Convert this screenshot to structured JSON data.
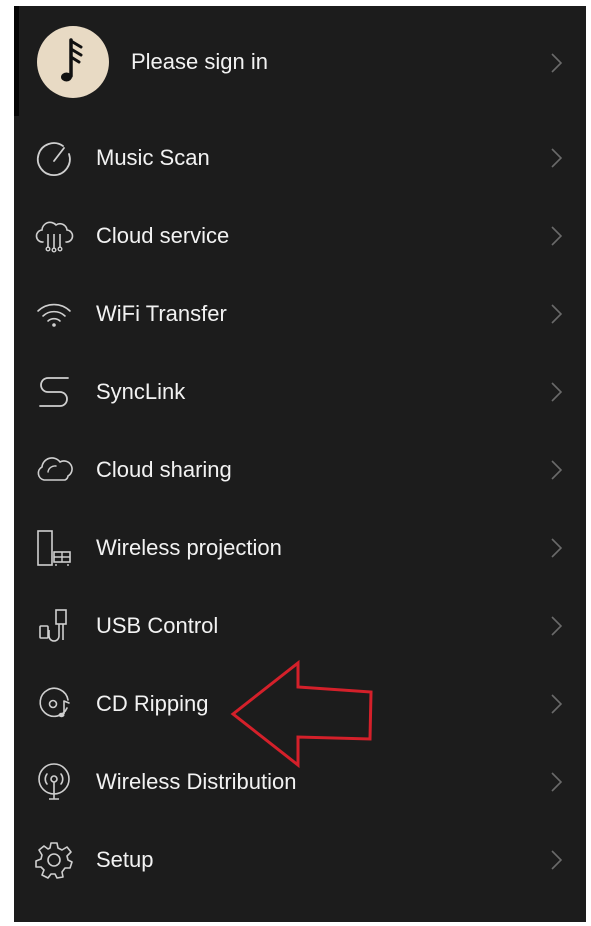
{
  "profile": {
    "label": "Please sign in",
    "avatar_icon": "music-note-icon"
  },
  "menu": {
    "items": [
      {
        "label": "Music Scan",
        "icon": "scan-dial-icon"
      },
      {
        "label": "Cloud service",
        "icon": "cloud-service-icon"
      },
      {
        "label": "WiFi Transfer",
        "icon": "wifi-icon"
      },
      {
        "label": "SyncLink",
        "icon": "synclink-icon"
      },
      {
        "label": "Cloud sharing",
        "icon": "cloud-icon"
      },
      {
        "label": "Wireless projection",
        "icon": "projection-icon"
      },
      {
        "label": "USB Control",
        "icon": "usb-icon"
      },
      {
        "label": "CD Ripping",
        "icon": "cd-icon"
      },
      {
        "label": "Wireless Distribution",
        "icon": "broadcast-icon"
      },
      {
        "label": "Setup",
        "icon": "gear-icon"
      }
    ]
  },
  "colors": {
    "background": "#1c1c1c",
    "text": "#f2f2f2",
    "icon": "#cfcfcf",
    "chevron": "#6a6a6a",
    "avatar_bg": "#e8dac4",
    "annotation_arrow": "#d4202a"
  }
}
